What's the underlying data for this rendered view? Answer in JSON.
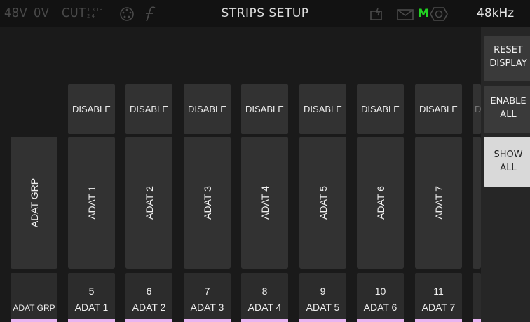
{
  "topbar": {
    "phantom_label": "48V",
    "zero_v_label": "0V",
    "cut_label": "CUT",
    "cut_digits_top": "1 3 TB",
    "cut_digits_bottom": "2 4",
    "title": "STRIPS SETUP",
    "m_label": "M",
    "sample_rate": "48kHz"
  },
  "right_panel": {
    "reset_line1": "RESET",
    "reset_line2": "DISPLAY",
    "enable_line1": "ENABLE",
    "enable_line2": "ALL",
    "show_line1": "SHOW",
    "show_line2": "ALL"
  },
  "disable_buttons": [
    "DISABLE",
    "DISABLE",
    "DISABLE",
    "DISABLE",
    "DISABLE",
    "DISABLE",
    "DISABLE",
    "D"
  ],
  "strips": [
    "ADAT GRP",
    "ADAT 1",
    "ADAT 2",
    "ADAT 3",
    "ADAT 4",
    "ADAT 5",
    "ADAT 6",
    "ADAT 7"
  ],
  "footer": [
    {
      "num": "",
      "label": "ADAT GRP"
    },
    {
      "num": "5",
      "label": "ADAT 1"
    },
    {
      "num": "6",
      "label": "ADAT 2"
    },
    {
      "num": "7",
      "label": "ADAT 3"
    },
    {
      "num": "8",
      "label": "ADAT 4"
    },
    {
      "num": "9",
      "label": "ADAT 5"
    },
    {
      "num": "10",
      "label": "ADAT 6"
    },
    {
      "num": "11",
      "label": "ADAT 7"
    }
  ],
  "colors": {
    "accent_pink": "#e8b4f0",
    "m_green": "#22d322"
  },
  "icons": [
    "dsp-icon",
    "f-script-icon",
    "phone-icon",
    "mail-icon",
    "speaker-icon"
  ]
}
